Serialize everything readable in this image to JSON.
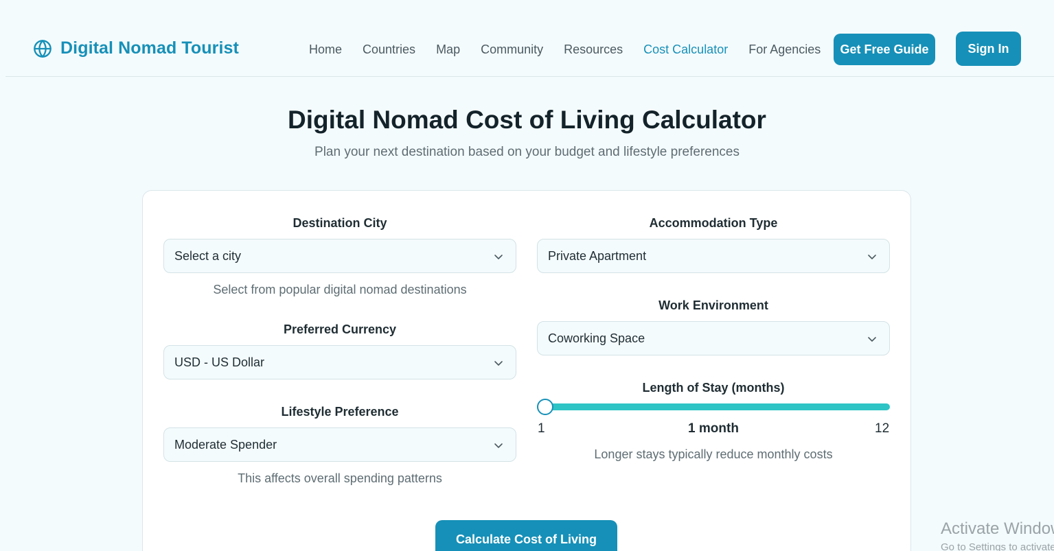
{
  "header": {
    "brand": "Digital Nomad Tourist",
    "brand_icon": "globe-icon",
    "nav": [
      {
        "label": "Home",
        "active": false
      },
      {
        "label": "Countries",
        "active": false
      },
      {
        "label": "Map",
        "active": false
      },
      {
        "label": "Community",
        "active": false
      },
      {
        "label": "Resources",
        "active": false
      },
      {
        "label": "Cost Calculator",
        "active": true
      },
      {
        "label": "For Agencies",
        "active": false
      }
    ],
    "guide_button": "Get Free Guide",
    "signin_button": "Sign In"
  },
  "main": {
    "title": "Digital Nomad Cost of Living Calculator",
    "subtitle": "Plan your next destination based on your budget and lifestyle preferences"
  },
  "form": {
    "destination": {
      "label": "Destination City",
      "value": "Select a city",
      "hint": "Select from popular digital nomad destinations"
    },
    "currency": {
      "label": "Preferred Currency",
      "value": "USD - US Dollar"
    },
    "lifestyle": {
      "label": "Lifestyle Preference",
      "value": "Moderate Spender",
      "hint": "This affects overall spending patterns"
    },
    "accommodation": {
      "label": "Accommodation Type",
      "value": "Private Apartment"
    },
    "work": {
      "label": "Work Environment",
      "value": "Coworking Space"
    },
    "stay": {
      "label": "Length of Stay (months)",
      "min": "1",
      "max": "12",
      "current": "1 month",
      "value": 1,
      "hint": "Longer stays typically reduce monthly costs"
    },
    "calculate_button": "Calculate Cost of Living"
  },
  "watermark": {
    "title": "Activate Windows",
    "subtitle": "Go to Settings to activate Windows."
  },
  "colors": {
    "accent": "#1690b8",
    "slider": "#2ec4c6",
    "background": "#f4fbfd"
  }
}
